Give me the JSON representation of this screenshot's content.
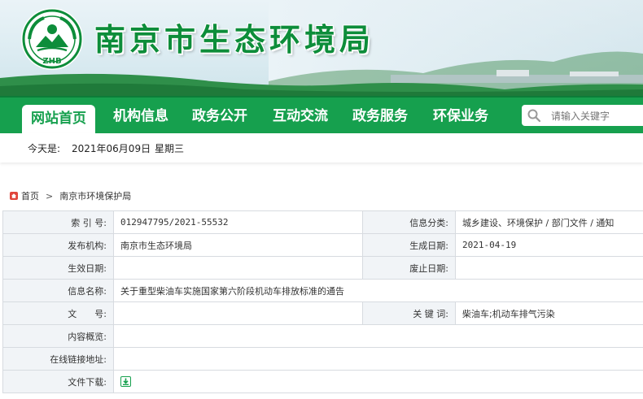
{
  "site": {
    "title": "南京市生态环境局",
    "logo_text": "ZHB"
  },
  "nav": {
    "items": [
      {
        "label": "网站首页",
        "active": true
      },
      {
        "label": "机构信息"
      },
      {
        "label": "政务公开"
      },
      {
        "label": "互动交流"
      },
      {
        "label": "政务服务"
      },
      {
        "label": "环保业务"
      }
    ],
    "search_placeholder": "请输入关键字"
  },
  "datebar": {
    "prefix": "今天是:",
    "date": "2021年06月09日",
    "weekday": "星期三"
  },
  "breadcrumb": {
    "home": "首页",
    "separator": ">",
    "current": "南京市环境保护局"
  },
  "info": {
    "index_label": "索 引 号:",
    "index_value": "012947795/2021-55532",
    "category_label": "信息分类:",
    "category_value": "城乡建设、环境保护 / 部门文件 / 通知",
    "publisher_label": "发布机构:",
    "publisher_value": "南京市生态环境局",
    "created_label": "生成日期:",
    "created_value": "2021-04-19",
    "effective_label": "生效日期:",
    "effective_value": "",
    "repealed_label": "废止日期:",
    "repealed_value": "",
    "name_label": "信息名称:",
    "name_value": "关于重型柴油车实施国家第六阶段机动车排放标准的通告",
    "docno_label": "文　　号:",
    "docno_value": "",
    "keywords_label": "关 键 词:",
    "keywords_value": "柴油车;机动车排气污染",
    "summary_label": "内容概览:",
    "summary_value": "",
    "link_label": "在线链接地址:",
    "link_value": "",
    "download_label": "文件下载:"
  },
  "colors": {
    "brand_green": "#16a04e",
    "title_green": "#0d8d3a",
    "label_bg": "#f1f4f7",
    "border": "#d7dbe0"
  },
  "icons": [
    "logo-emblem",
    "search-icon",
    "home-icon",
    "download-icon"
  ]
}
